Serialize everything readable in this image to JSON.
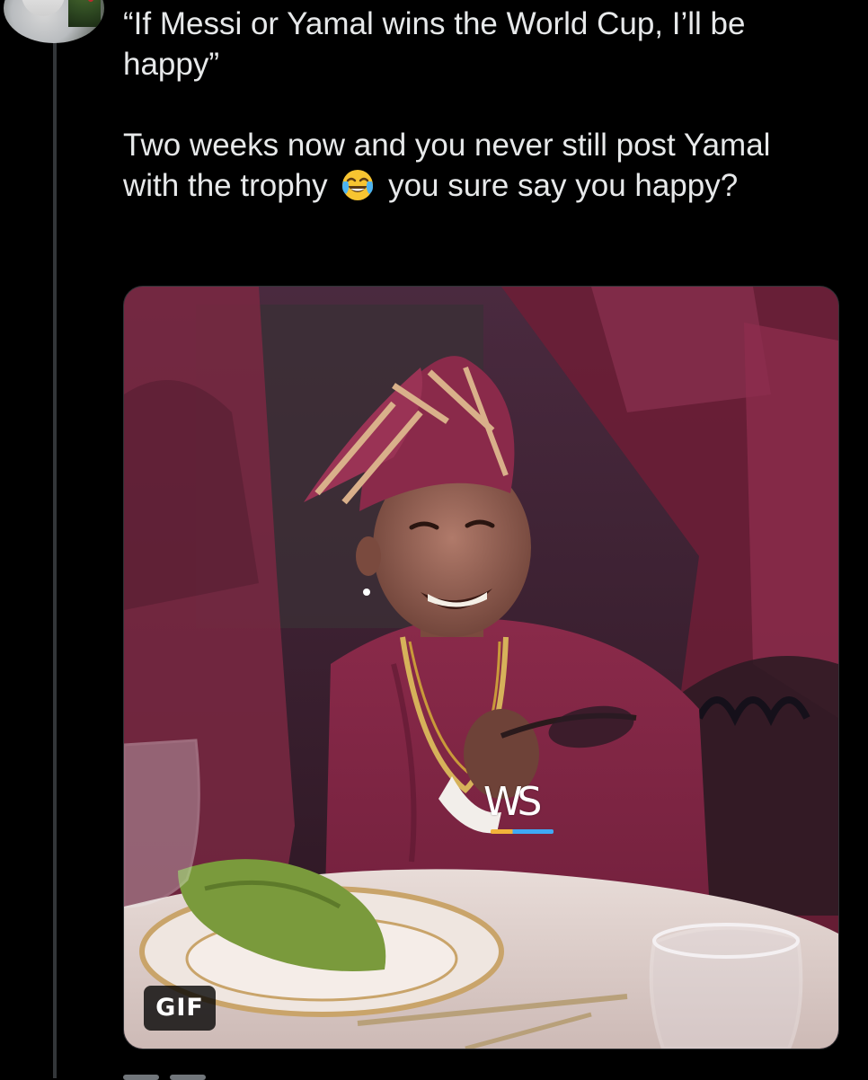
{
  "tweet": {
    "paragraph1": "“If Messi or Yamal wins the World Cup, I’ll be happy”",
    "paragraph2_before": "Two weeks now and you never still post Yamal with the trophy",
    "paragraph2_emoji": "face-with-tears-of-joy-icon",
    "paragraph2_after": "you sure say you happy?"
  },
  "media": {
    "type": "gif",
    "badge_label": "GIF",
    "watermark": "WS"
  },
  "colors": {
    "background": "#000000",
    "text": "#e7e9ea",
    "thread_line": "#333639",
    "outfit_maroon": "#7a2240"
  }
}
